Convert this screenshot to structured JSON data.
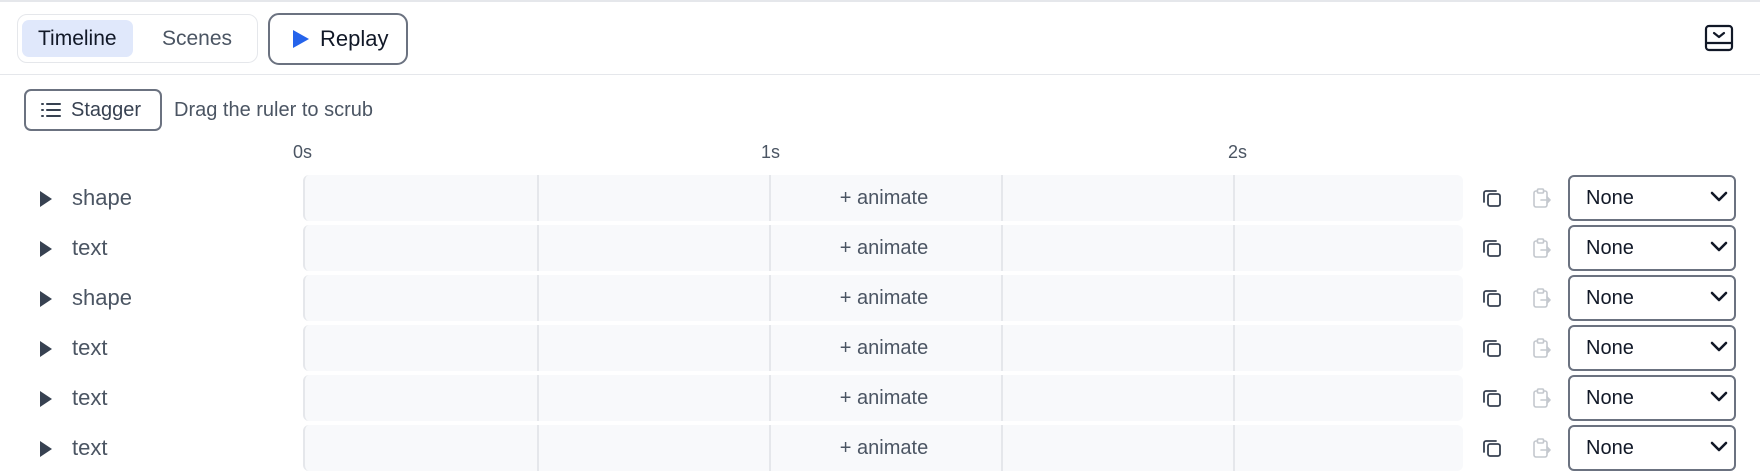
{
  "header": {
    "tabs": [
      {
        "label": "Timeline",
        "active": true
      },
      {
        "label": "Scenes",
        "active": false
      }
    ],
    "replay_label": "Replay",
    "collapse_icon": "collapse-panel-icon"
  },
  "toolbar": {
    "stagger_label": "Stagger",
    "hint": "Drag the ruler to scrub"
  },
  "ruler": {
    "ticks": [
      "0s",
      "1s",
      "2s"
    ]
  },
  "rows": [
    {
      "name": "shape",
      "animate_label": "+ animate",
      "easing": "None"
    },
    {
      "name": "text",
      "animate_label": "+ animate",
      "easing": "None"
    },
    {
      "name": "shape",
      "animate_label": "+ animate",
      "easing": "None"
    },
    {
      "name": "text",
      "animate_label": "+ animate",
      "easing": "None"
    },
    {
      "name": "text",
      "animate_label": "+ animate",
      "easing": "None"
    },
    {
      "name": "text",
      "animate_label": "+ animate",
      "easing": "None"
    }
  ],
  "colors": {
    "accent": "#2563eb",
    "active_tab_bg": "#e0e8fb",
    "track_bg": "#f8f9fb",
    "border": "#6b7280"
  }
}
